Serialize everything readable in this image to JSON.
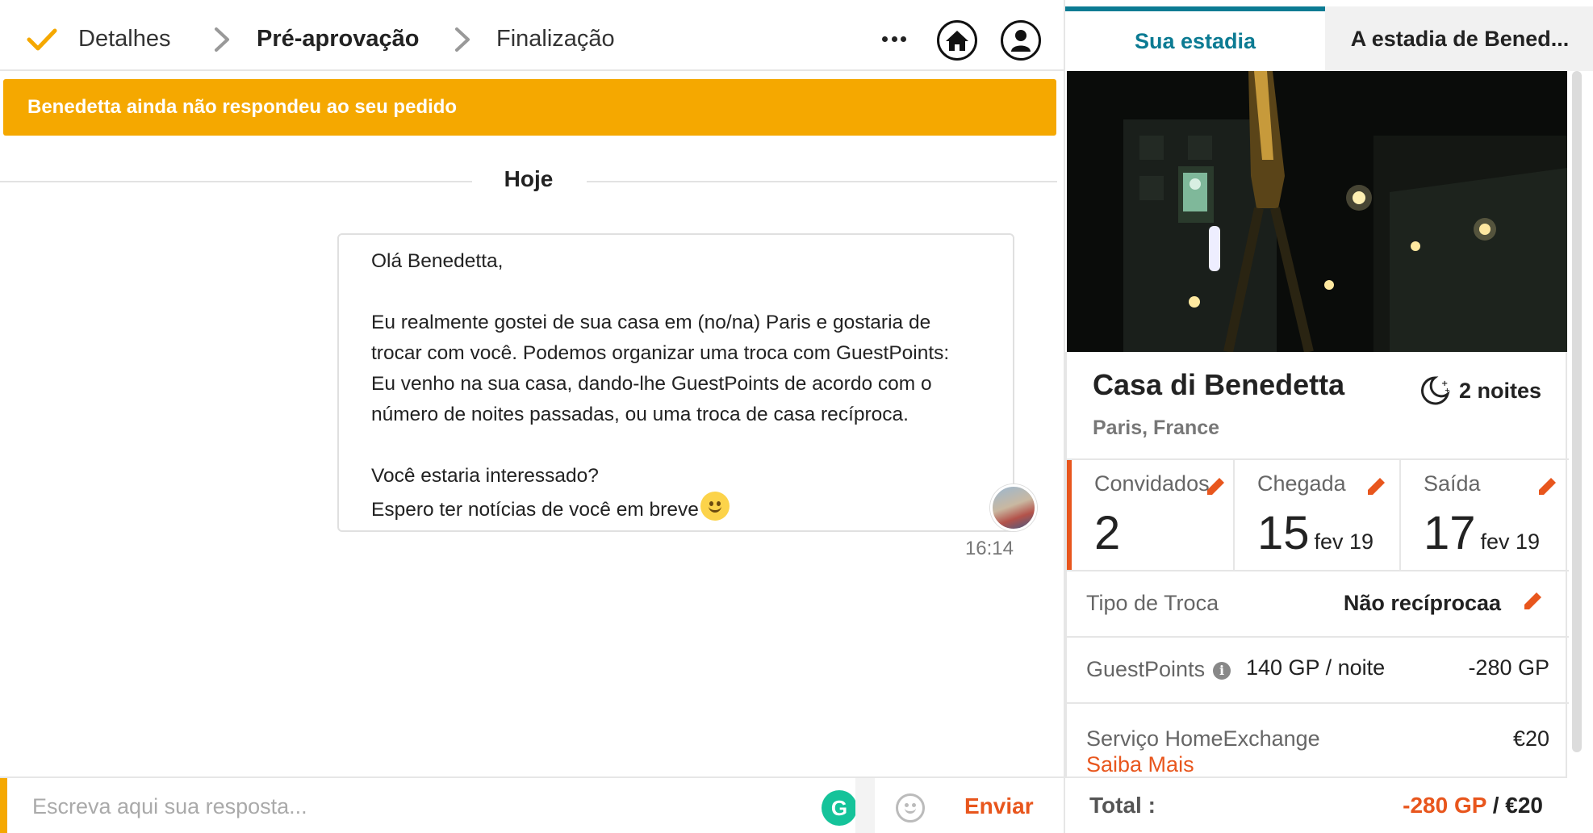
{
  "steps": {
    "details": "Detalhes",
    "preapproval": "Pré-aprovação",
    "finalization": "Finalização"
  },
  "banner": "Benedetta ainda não respondeu ao seu pedido",
  "day_divider": "Hoje",
  "message": {
    "greeting": "Olá Benedetta,",
    "body_lines": [
      "Eu realmente gostei de sua casa em (no/na) Paris e gostaria de",
      "trocar com você. Podemos organizar uma troca com GuestPoints:",
      "Eu venho na sua casa, dando-lhe GuestPoints de acordo com o",
      "número de noites passadas, ou uma troca de casa recíproca."
    ],
    "question": "Você estaria interessado?",
    "closing": "Espero ter notícias de você em breve",
    "time": "16:14"
  },
  "composer": {
    "placeholder": "Escreva aqui sua resposta...",
    "grammarly": "G",
    "send_label": "Enviar"
  },
  "tabs": {
    "your_stay": "Sua estadia",
    "host_stay": "A estadia de Bened..."
  },
  "property": {
    "name": "Casa di Benedetta",
    "location": "Paris, France",
    "nights": "2 noites"
  },
  "booking": {
    "guests_label": "Convidados",
    "guests_value": "2",
    "arrival_label": "Chegada",
    "arrival_day": "15",
    "arrival_month": "fev 19",
    "departure_label": "Saída",
    "departure_day": "17",
    "departure_month": "fev 19"
  },
  "exchange_type": {
    "label": "Tipo de Troca",
    "value": "Não recíprocaa"
  },
  "guestpoints": {
    "label": "GuestPoints",
    "rate": "140 GP / noite",
    "amount": "-280 GP"
  },
  "service": {
    "label": "Serviço HomeExchange",
    "amount": "€20",
    "learn_more": "Saiba Mais"
  },
  "total": {
    "label": "Total :",
    "gp": "-280 GP",
    "separator": " / ",
    "eur": "€20"
  },
  "colors": {
    "accent_orange": "#e8561d",
    "banner_yellow": "#f5a800",
    "tab_teal": "#0c7b93",
    "grammarly_green": "#15c39a"
  },
  "icons": [
    "check-icon",
    "chevron-right-icon",
    "more-icon",
    "home-icon",
    "user-icon",
    "moon-icon",
    "pencil-icon",
    "info-icon",
    "emoji-icon",
    "grammarly-icon"
  ]
}
